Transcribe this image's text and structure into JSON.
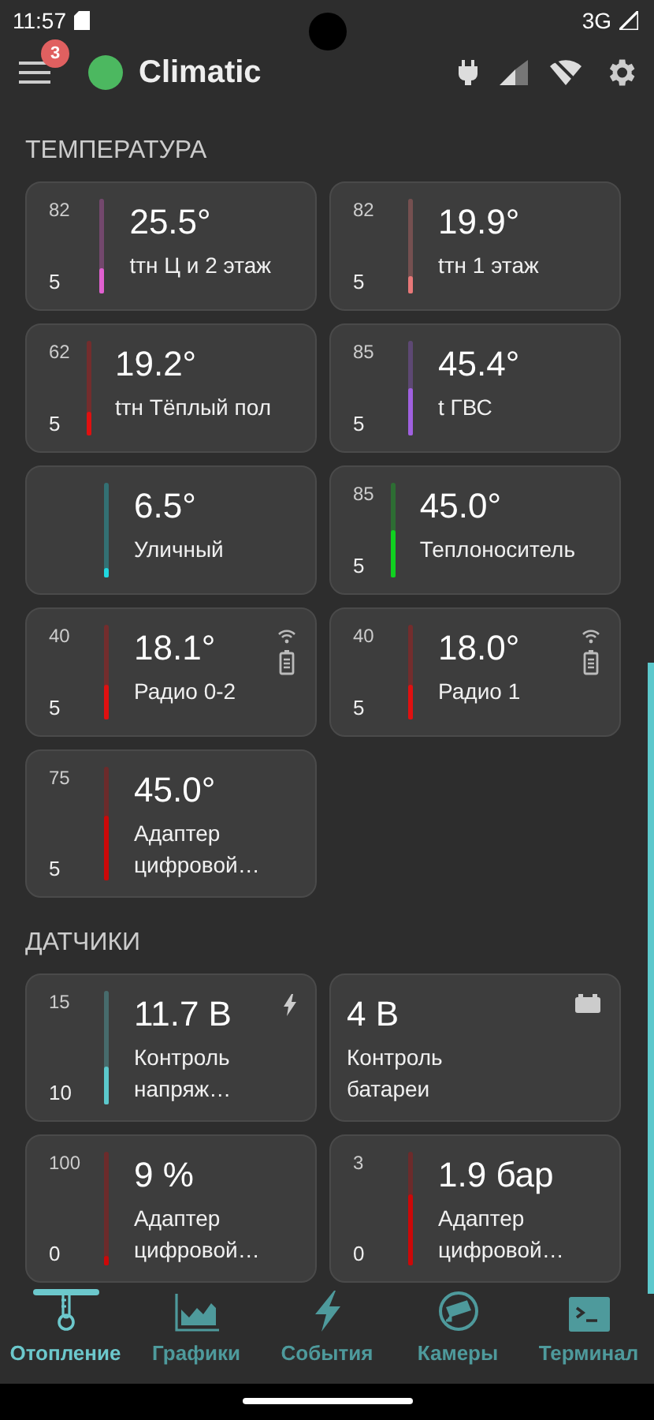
{
  "status_bar": {
    "time": "11:57",
    "network": "3G"
  },
  "header": {
    "title": "Climatic",
    "notifications": "3",
    "online": true
  },
  "sections": [
    {
      "title": "ТЕМПЕРАТУРА",
      "cards": [
        {
          "kind": "gauge",
          "max": "82",
          "min": "5",
          "level": 0.27,
          "color": "#e060d0",
          "value": "25.5°",
          "label": [
            "tтн Ц и 2 этаж"
          ]
        },
        {
          "kind": "gauge",
          "max": "82",
          "min": "5",
          "level": 0.19,
          "color": "#e87878",
          "value": "19.9°",
          "label": [
            "tтн 1 этаж"
          ]
        },
        {
          "kind": "gauge",
          "max": "62",
          "min": "5",
          "level": 0.25,
          "color": "#e01010",
          "value": "19.2°",
          "label": [
            "tтн Тёплый пол"
          ]
        },
        {
          "kind": "gauge",
          "max": "85",
          "min": "5",
          "level": 0.5,
          "color": "#a060e0",
          "value": "45.4°",
          "label": [
            "t ГВС"
          ]
        },
        {
          "kind": "gauge",
          "level": 0.06,
          "color": "#20d8e0",
          "value": "6.5°",
          "label": [
            "Уличный"
          ]
        },
        {
          "kind": "gauge",
          "max": "85",
          "min": "5",
          "level": 0.5,
          "color": "#10d020",
          "value": "45.0°",
          "label": [
            "Теплоноситель"
          ]
        },
        {
          "kind": "gauge",
          "max": "40",
          "min": "5",
          "level": 0.37,
          "color": "#e01010",
          "value": "18.1°",
          "label": [
            "Радио 0-2"
          ],
          "indicator": {
            "kind": "radio"
          }
        },
        {
          "kind": "gauge",
          "max": "40",
          "min": "5",
          "level": 0.37,
          "color": "#e01010",
          "value": "18.0°",
          "label": [
            "Радио 1"
          ],
          "indicator": {
            "kind": "radio"
          }
        },
        {
          "kind": "gauge",
          "max": "75",
          "min": "5",
          "level": 0.57,
          "color": "#cc0808",
          "value": "45.0°",
          "label": [
            "Адаптер",
            "цифровой…"
          ]
        }
      ]
    },
    {
      "title": "ДАТЧИКИ",
      "cards": [
        {
          "kind": "gauge",
          "max": "15",
          "min": "10",
          "level": 0.34,
          "color": "#5cc8cc",
          "value": "11.7 В",
          "label": [
            "Контроль",
            "напряж…"
          ],
          "indicator": {
            "kind": "voltage"
          }
        },
        {
          "kind": "plain",
          "value": "4 В",
          "label": [
            "Контроль",
            "батареи"
          ],
          "indicator": {
            "kind": "battery"
          }
        },
        {
          "kind": "gauge",
          "max": "100",
          "min": "0",
          "level": 0.09,
          "color": "#cc0808",
          "value": "9 %",
          "label": [
            "Адаптер",
            "цифровой…"
          ]
        },
        {
          "kind": "gauge",
          "max": "3",
          "min": "0",
          "level": 0.63,
          "color": "#cc0808",
          "value": "1.9 бар",
          "label": [
            "Адаптер",
            "цифровой…"
          ]
        }
      ]
    }
  ],
  "nav": [
    {
      "kind": "heating",
      "label": "Отопление",
      "selected": true
    },
    {
      "kind": "charts",
      "label": "Графики",
      "selected": false
    },
    {
      "kind": "events",
      "label": "События",
      "selected": false
    },
    {
      "kind": "cameras",
      "label": "Камеры",
      "selected": false
    },
    {
      "kind": "terminal",
      "label": "Терминал",
      "selected": false
    }
  ]
}
